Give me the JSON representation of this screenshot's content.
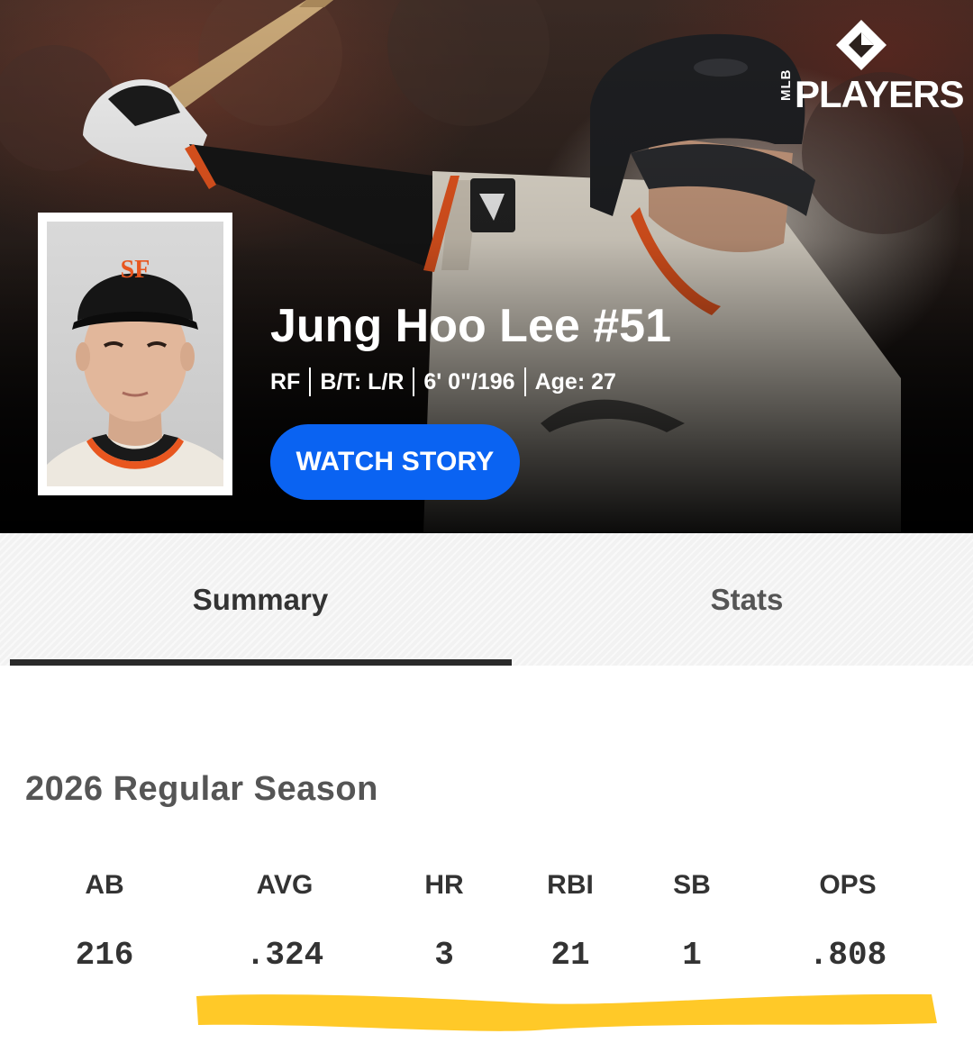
{
  "brand": {
    "mlb": "MLB",
    "players": "PLAYERS"
  },
  "player": {
    "name": "Jung Hoo Lee #51",
    "bio": [
      "RF",
      "B/T: L/R",
      "6' 0\"/196",
      "Age: 27"
    ],
    "watch_label": "WATCH STORY"
  },
  "tabs": [
    {
      "label": "Summary",
      "active": true
    },
    {
      "label": "Stats",
      "active": false
    }
  ],
  "season": {
    "title": "2026 Regular Season",
    "stats": [
      {
        "label": "AB",
        "value": "216"
      },
      {
        "label": "AVG",
        "value": ".324"
      },
      {
        "label": "HR",
        "value": "3"
      },
      {
        "label": "RBI",
        "value": "21"
      },
      {
        "label": "SB",
        "value": "1"
      },
      {
        "label": "OPS",
        "value": ".808"
      }
    ]
  },
  "colors": {
    "accent": "#0a63f2",
    "highlight": "#ffc928",
    "giants_orange": "#e8561f"
  }
}
